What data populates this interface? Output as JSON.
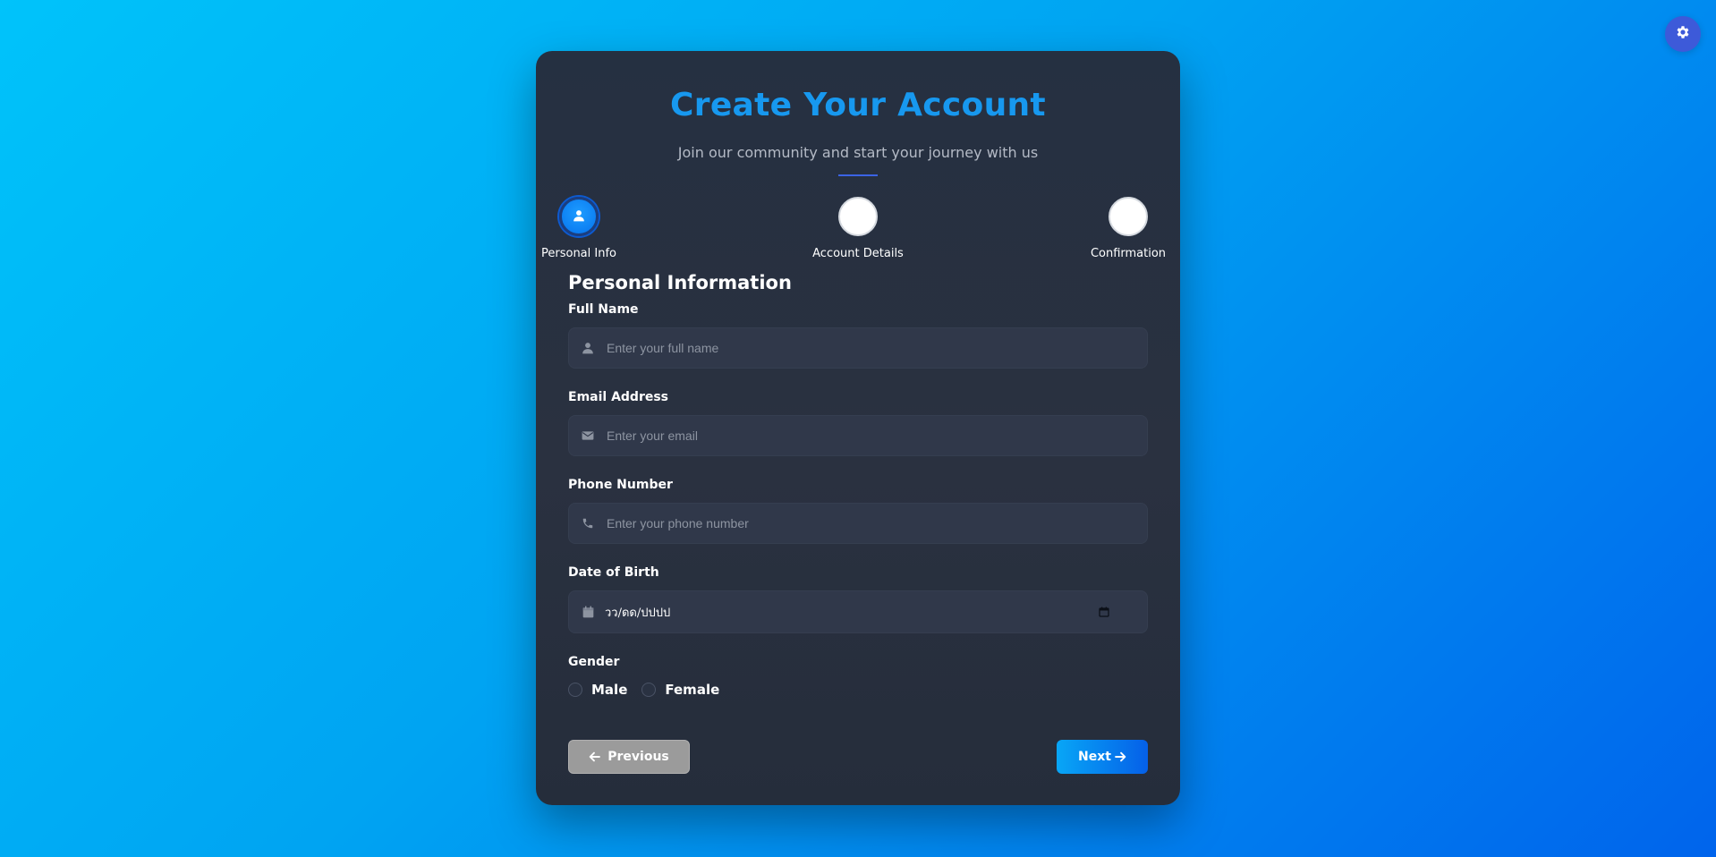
{
  "header": {
    "title": "Create Your Account",
    "subtitle": "Join our community and start your journey with us"
  },
  "steps": [
    {
      "label": "Personal Info",
      "icon": "user-icon",
      "active": true
    },
    {
      "label": "Account Details",
      "active": false
    },
    {
      "label": "Confirmation",
      "active": false
    }
  ],
  "form": {
    "section_title": "Personal Information",
    "full_name": {
      "label": "Full Name",
      "placeholder": "Enter your full name",
      "value": "",
      "icon": "user-icon"
    },
    "email": {
      "label": "Email Address",
      "placeholder": "Enter your email",
      "value": "",
      "icon": "envelope-icon"
    },
    "phone": {
      "label": "Phone Number",
      "placeholder": "Enter your phone number",
      "value": "",
      "icon": "phone-icon"
    },
    "dob": {
      "label": "Date of Birth",
      "display": "วว/ดด/ปปปป",
      "icon": "calendar-icon"
    },
    "gender": {
      "label": "Gender",
      "options": [
        "Male",
        "Female"
      ],
      "selected": null
    }
  },
  "buttons": {
    "previous": "Previous",
    "next": "Next"
  },
  "theme_toggle": {
    "icon": "gear-icon"
  },
  "colors": {
    "accent": "#1798ef",
    "background_start": "#00c3fa",
    "background_end": "#0064ec",
    "card": "#2a3140",
    "previous_button": "#9b9b9b"
  }
}
